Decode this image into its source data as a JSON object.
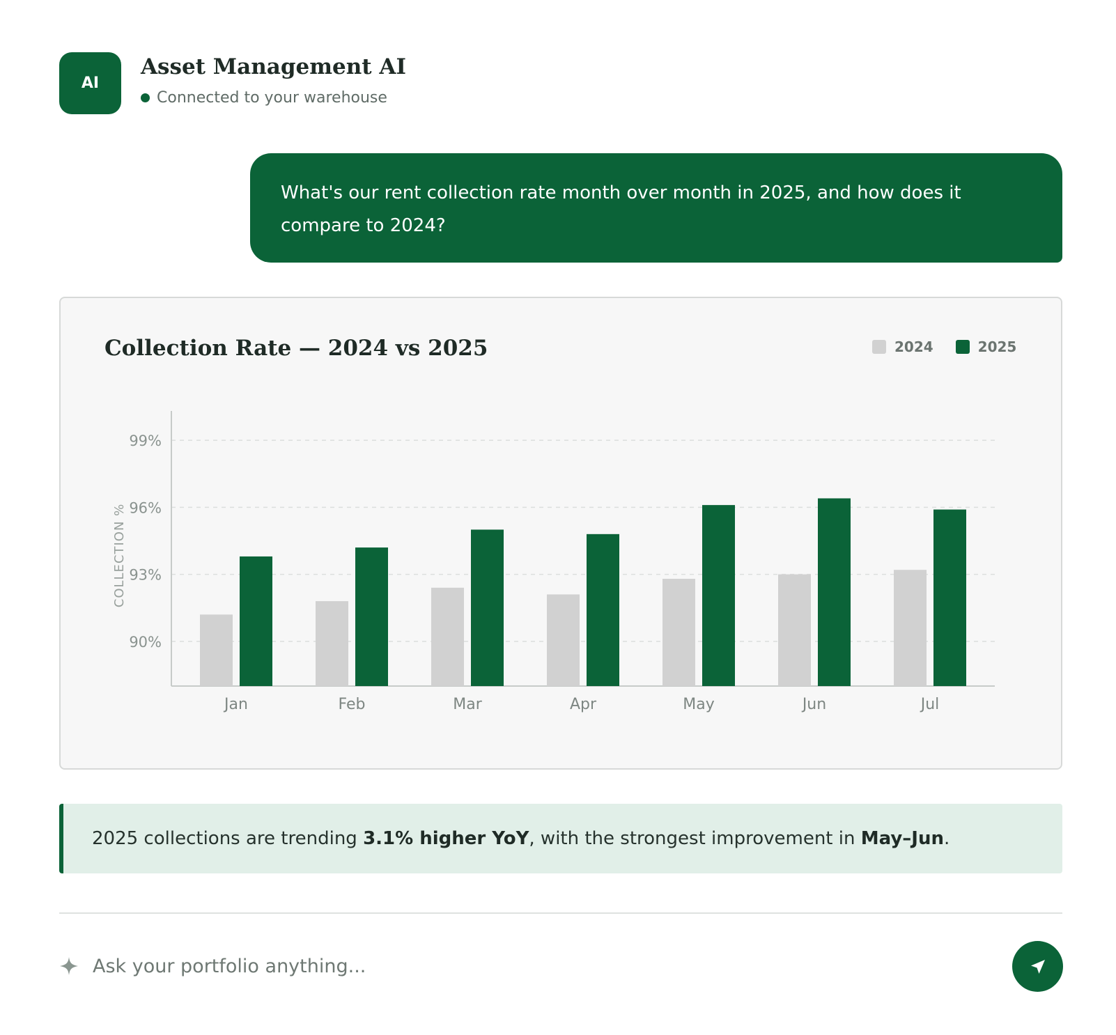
{
  "header": {
    "avatar_label": "AI",
    "title": "Asset Management AI",
    "status": "Connected to your warehouse"
  },
  "conversation": {
    "user_message": "What's our rent collection rate month over month in 2025, and how does it compare to 2024?"
  },
  "insight": {
    "prefix": "2025 collections are trending ",
    "highlight_1": "3.1% higher YoY",
    "middle": ", with the strongest improvement in ",
    "highlight_2": "May–Jun",
    "suffix": "."
  },
  "composer": {
    "placeholder": "Ask your portfolio anything...",
    "icon": "sparkle-icon",
    "send_icon": "send-icon"
  },
  "colors": {
    "accent": "#0b6338",
    "series_2024": "#d1d1d1",
    "series_2025": "#0b6338"
  },
  "chart_data": {
    "type": "bar",
    "title": "Collection Rate — 2024 vs 2025",
    "xlabel": "",
    "ylabel": "COLLECTION %",
    "categories": [
      "Jan",
      "Feb",
      "Mar",
      "Apr",
      "May",
      "Jun",
      "Jul"
    ],
    "series": [
      {
        "name": "2024",
        "values": [
          91.2,
          91.8,
          92.4,
          92.1,
          92.8,
          93.0,
          93.2
        ]
      },
      {
        "name": "2025",
        "values": [
          93.8,
          94.2,
          95.0,
          94.8,
          96.1,
          96.4,
          95.9
        ]
      }
    ],
    "ylim": [
      88,
      100
    ],
    "yticks": [
      90,
      93,
      96,
      99
    ],
    "ytick_labels": [
      "90%",
      "93%",
      "96%",
      "99%"
    ],
    "grid": true,
    "legend": "top-right"
  }
}
